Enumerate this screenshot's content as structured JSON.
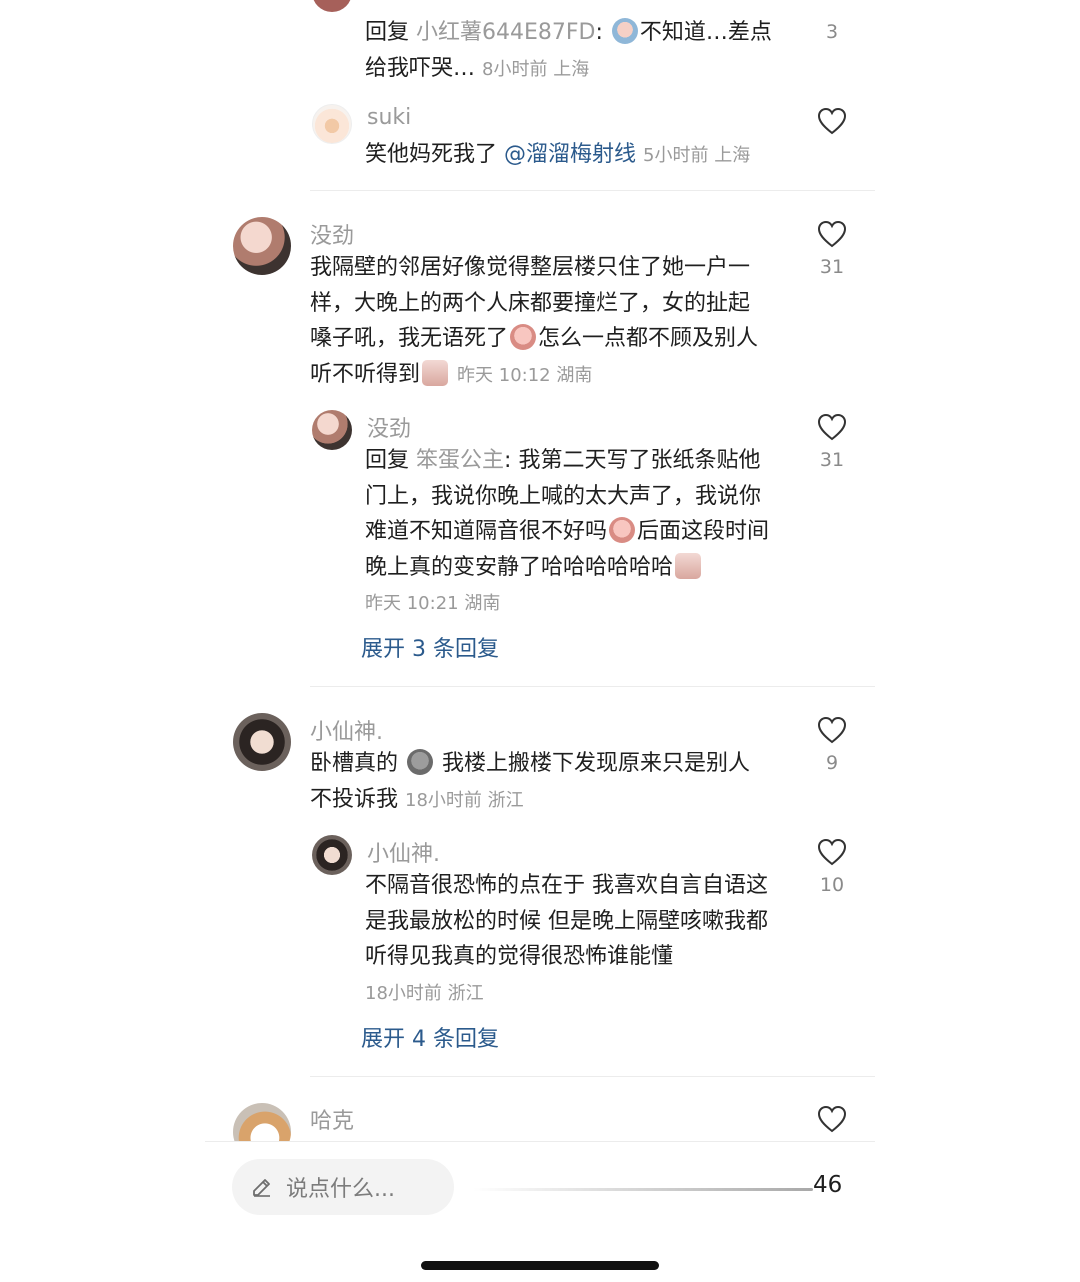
{
  "comments": [
    {
      "reply_prefix": "回复",
      "reply_to": "小红薯644E87FD",
      "text_a": "不知道…差点",
      "text_b": "给我吓哭…",
      "meta": "8小时前 上海",
      "likes": "3"
    },
    {
      "user": "suki",
      "text": "笑他妈死我了",
      "mention": "@溜溜梅射线",
      "meta": "5小时前 上海"
    },
    {
      "user": "没劲",
      "line1": "我隔壁的邻居好像觉得整层楼只住了她一户一",
      "line2": "样，大晚上的两个人床都要撞烂了，女的扯起",
      "line3a": "嗓子吼，我无语死了",
      "line3b": "怎么一点都不顾及别人",
      "line4": "听不听得到",
      "meta": "昨天 10:12 湖南",
      "likes": "31"
    },
    {
      "user": "没劲",
      "reply_prefix": "回复",
      "reply_to": "笨蛋公主",
      "line1": "我第二天写了张纸条贴他",
      "line2": "门上，我说你晚上喊的太大声了，我说你",
      "line3a": "难道不知道隔音很不好吗",
      "line3b": "后面这段时间",
      "line4": "晚上真的变安静了哈哈哈哈哈哈",
      "meta": "昨天 10:21 湖南",
      "likes": "31"
    },
    {
      "user": "小仙神.",
      "line1a": "卧槽真的",
      "line1b": "我楼上搬楼下发现原来只是别人",
      "line2": "不投诉我",
      "meta": "18小时前 浙江",
      "likes": "9"
    },
    {
      "user": "小仙神.",
      "line1": "不隔音很恐怖的点在于 我喜欢自言自语这",
      "line2": "是我最放松的时候 但是晚上隔壁咳嗽我都",
      "line3": "听得见我真的觉得很恐怖谁能懂",
      "meta": "18小时前 浙江",
      "likes": "10"
    },
    {
      "user": "哈克"
    }
  ],
  "expand_1": "展开 3 条回复",
  "expand_2": "展开 4 条回复",
  "input_placeholder": "说点什么...",
  "total_count": "46",
  "colors": {
    "username": "#9a9a9a",
    "link": "#2b5a8c",
    "text": "#1f1f1f"
  },
  "icons": [
    "heart-outline-icon",
    "pencil-icon",
    "emoji-stickers"
  ]
}
